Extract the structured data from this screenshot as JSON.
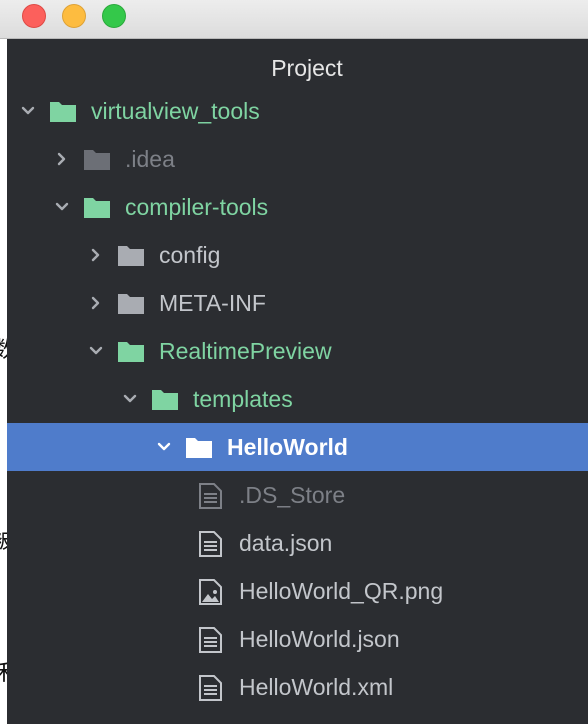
{
  "window": {
    "buttons": [
      "close",
      "minimize",
      "maximize"
    ]
  },
  "panel": {
    "title": "Project"
  },
  "tree": [
    {
      "label": "virtualview_tools",
      "depth": 0,
      "kind": "folder",
      "expanded": true,
      "color": "#7fd4a2",
      "icon_color": "#7fd4a2"
    },
    {
      "label": ".idea",
      "depth": 1,
      "kind": "folder",
      "expanded": false,
      "color": "#7d8087",
      "icon_color": "#6c6f76"
    },
    {
      "label": "compiler-tools",
      "depth": 1,
      "kind": "folder",
      "expanded": true,
      "color": "#7fd4a2",
      "icon_color": "#7fd4a2"
    },
    {
      "label": "config",
      "depth": 2,
      "kind": "folder",
      "expanded": false,
      "color": "#c3c6cb",
      "icon_color": "#a9acb2"
    },
    {
      "label": "META-INF",
      "depth": 2,
      "kind": "folder",
      "expanded": false,
      "color": "#c3c6cb",
      "icon_color": "#a9acb2"
    },
    {
      "label": "RealtimePreview",
      "depth": 2,
      "kind": "folder",
      "expanded": true,
      "color": "#7fd4a2",
      "icon_color": "#7fd4a2"
    },
    {
      "label": "templates",
      "depth": 3,
      "kind": "folder",
      "expanded": true,
      "color": "#7fd4a2",
      "icon_color": "#7fd4a2"
    },
    {
      "label": "HelloWorld",
      "depth": 4,
      "kind": "folder",
      "expanded": true,
      "selected": true,
      "color": "#ffffff",
      "icon_color": "#ffffff"
    },
    {
      "label": ".DS_Store",
      "depth": 5,
      "kind": "file",
      "color": "#7d8087",
      "icon_color": "#7d8087"
    },
    {
      "label": "data.json",
      "depth": 5,
      "kind": "file",
      "color": "#c3c6cb",
      "icon_color": "#c3c6cb"
    },
    {
      "label": "HelloWorld_QR.png",
      "depth": 5,
      "kind": "image",
      "color": "#c3c6cb",
      "icon_color": "#c3c6cb"
    },
    {
      "label": "HelloWorld.json",
      "depth": 5,
      "kind": "file",
      "color": "#c3c6cb",
      "icon_color": "#c3c6cb"
    },
    {
      "label": "HelloWorld.xml",
      "depth": 5,
      "kind": "file",
      "color": "#c3c6cb",
      "icon_color": "#c3c6cb"
    }
  ],
  "background_glyphs": [
    "数",
    "被",
    "禾"
  ]
}
